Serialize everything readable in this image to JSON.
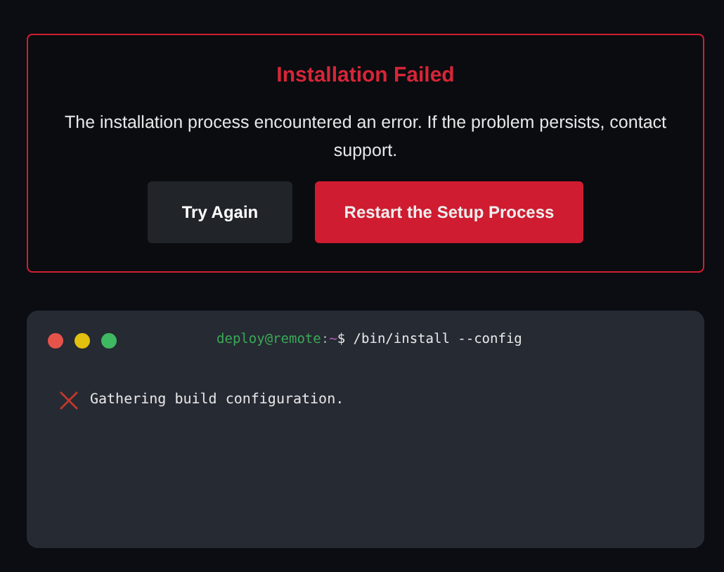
{
  "error_card": {
    "title": "Installation Failed",
    "message": "The installation process encountered an error. If the problem persists, contact support.",
    "buttons": [
      {
        "label": "Try Again",
        "kind": "secondary"
      },
      {
        "label": "Restart the Setup Process",
        "kind": "danger"
      }
    ]
  },
  "terminal": {
    "prompt": {
      "user_host": "deploy@remote",
      "separator": ":",
      "path": "~",
      "symbol": "$",
      "command": "/bin/install --config"
    },
    "lines": [
      {
        "failed": true,
        "text": "Gathering build configuration."
      }
    ]
  }
}
